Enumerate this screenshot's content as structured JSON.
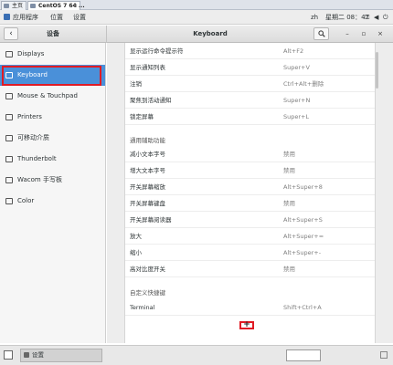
{
  "vm_tabs": [
    {
      "label": "主页",
      "close": "×"
    },
    {
      "label": "CentOS 7 64 ...",
      "close": "×"
    }
  ],
  "topbar": {
    "applications": "应用程序",
    "places": "位置",
    "settings": "设置",
    "user": "zh",
    "clock": "星期二 08：47"
  },
  "headerbar": {
    "sidebar_title": "设备",
    "main_title": "Keyboard",
    "search_icon": "search-icon",
    "minimize": "–",
    "maximize": "▫",
    "close": "×"
  },
  "sidebar": {
    "items": [
      {
        "label": "Displays",
        "icon": "display-icon"
      },
      {
        "label": "Keyboard",
        "icon": "keyboard-icon",
        "active": true
      },
      {
        "label": "Mouse & Touchpad",
        "icon": "mouse-icon"
      },
      {
        "label": "Printers",
        "icon": "printer-icon"
      },
      {
        "label": "可移动介质",
        "icon": "media-icon"
      },
      {
        "label": "Thunderbolt",
        "icon": "thunderbolt-icon"
      },
      {
        "label": "Wacom 手写板",
        "icon": "tablet-icon"
      },
      {
        "label": "Color",
        "icon": "color-icon"
      }
    ]
  },
  "shortcuts": {
    "group1": [
      {
        "name": "显示运行命令提示符",
        "key": "Alt+F2"
      },
      {
        "name": "显示通知列表",
        "key": "Super+V"
      },
      {
        "name": "注销",
        "key": "Ctrl+Alt+删除"
      },
      {
        "name": "聚焦到活动通知",
        "key": "Super+N"
      },
      {
        "name": "锁定屏幕",
        "key": "Super+L"
      }
    ],
    "accessibility_heading": "通用辅助功能",
    "accessibility": [
      {
        "name": "减小文本字号",
        "key": "禁用"
      },
      {
        "name": "增大文本字号",
        "key": "禁用"
      },
      {
        "name": "开关屏幕缩放",
        "key": "Alt+Super+8"
      },
      {
        "name": "开关屏幕键盘",
        "key": "禁用"
      },
      {
        "name": "开关屏幕阅读器",
        "key": "Alt+Super+S"
      },
      {
        "name": "放大",
        "key": "Alt+Super+="
      },
      {
        "name": "缩小",
        "key": "Alt+Super+-"
      },
      {
        "name": "高对比度开关",
        "key": "禁用"
      }
    ],
    "custom_heading": "自定义快捷键",
    "custom": [
      {
        "name": "Terminal",
        "key": "Shift+Ctrl+A"
      }
    ],
    "add_label": "+"
  },
  "bottombar": {
    "task_label": "设置"
  },
  "colors": {
    "accent": "#4a90d9",
    "highlight_box": "#e01b24"
  }
}
